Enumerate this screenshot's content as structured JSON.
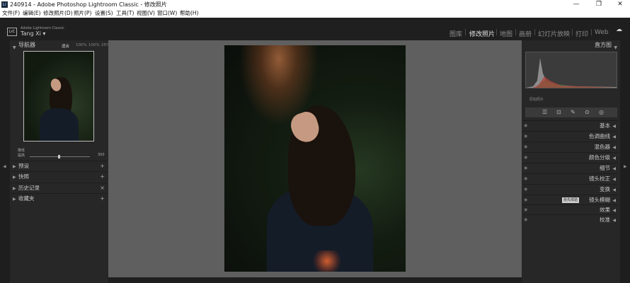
{
  "window": {
    "title": "240914 - Adobe Photoshop Lightroom Classic - 修改照片",
    "app_icon": "Lr",
    "minimize": "—",
    "maximize": "❐",
    "close": "✕"
  },
  "menu": [
    "文件(F)",
    "编辑(E)",
    "修改照片(D)",
    "照片(P)",
    "设置(S)",
    "工具(T)",
    "视图(V)",
    "窗口(W)",
    "帮助(H)"
  ],
  "identity": {
    "badge": "LrC",
    "product": "Adobe Lightroom Classic",
    "user": "Tang Xi ▾"
  },
  "modules": [
    {
      "label": "图库"
    },
    {
      "label": "修改照片"
    },
    {
      "label": "地图"
    },
    {
      "label": "画册"
    },
    {
      "label": "幻灯片放映"
    },
    {
      "label": "打印"
    },
    {
      "label": "Web"
    }
  ],
  "module_separator": "|",
  "active_module": "修改照片",
  "left_panel": {
    "navigator_title": "导航器",
    "zoom_options": [
      "适合",
      "100%",
      "100%",
      "25%"
    ],
    "slider_labels": [
      "降低",
      "提高"
    ],
    "slider_values": [
      "0",
      "300"
    ],
    "sections": [
      {
        "label": "预设",
        "plus": "+"
      },
      {
        "label": "快照",
        "plus": "+"
      },
      {
        "label": "历史记录",
        "plus": "×"
      },
      {
        "label": "收藏夹",
        "plus": "+"
      }
    ]
  },
  "right_panel": {
    "histogram_title": "直方图",
    "histogram_label": "原始照片",
    "tool_icons": [
      "sliders-icon",
      "crop-icon",
      "brush-icon",
      "eye-icon",
      "mask-icon"
    ],
    "tool_glyphs": [
      "☰",
      "⊡",
      "✎",
      "⊙",
      "◎"
    ],
    "sections": [
      {
        "label": "基本"
      },
      {
        "label": "色调曲线"
      },
      {
        "label": "混色器"
      },
      {
        "label": "颜色分级"
      },
      {
        "label": "细节"
      },
      {
        "label": "镜头校正"
      },
      {
        "label": "变换"
      },
      {
        "label": "镜头模糊",
        "badge": "抢先体验"
      },
      {
        "label": "效果"
      },
      {
        "label": "校准"
      }
    ]
  },
  "colors": {
    "accent": "#e5e5e5",
    "panel": "#272727",
    "canvas": "#5f5f5f"
  }
}
